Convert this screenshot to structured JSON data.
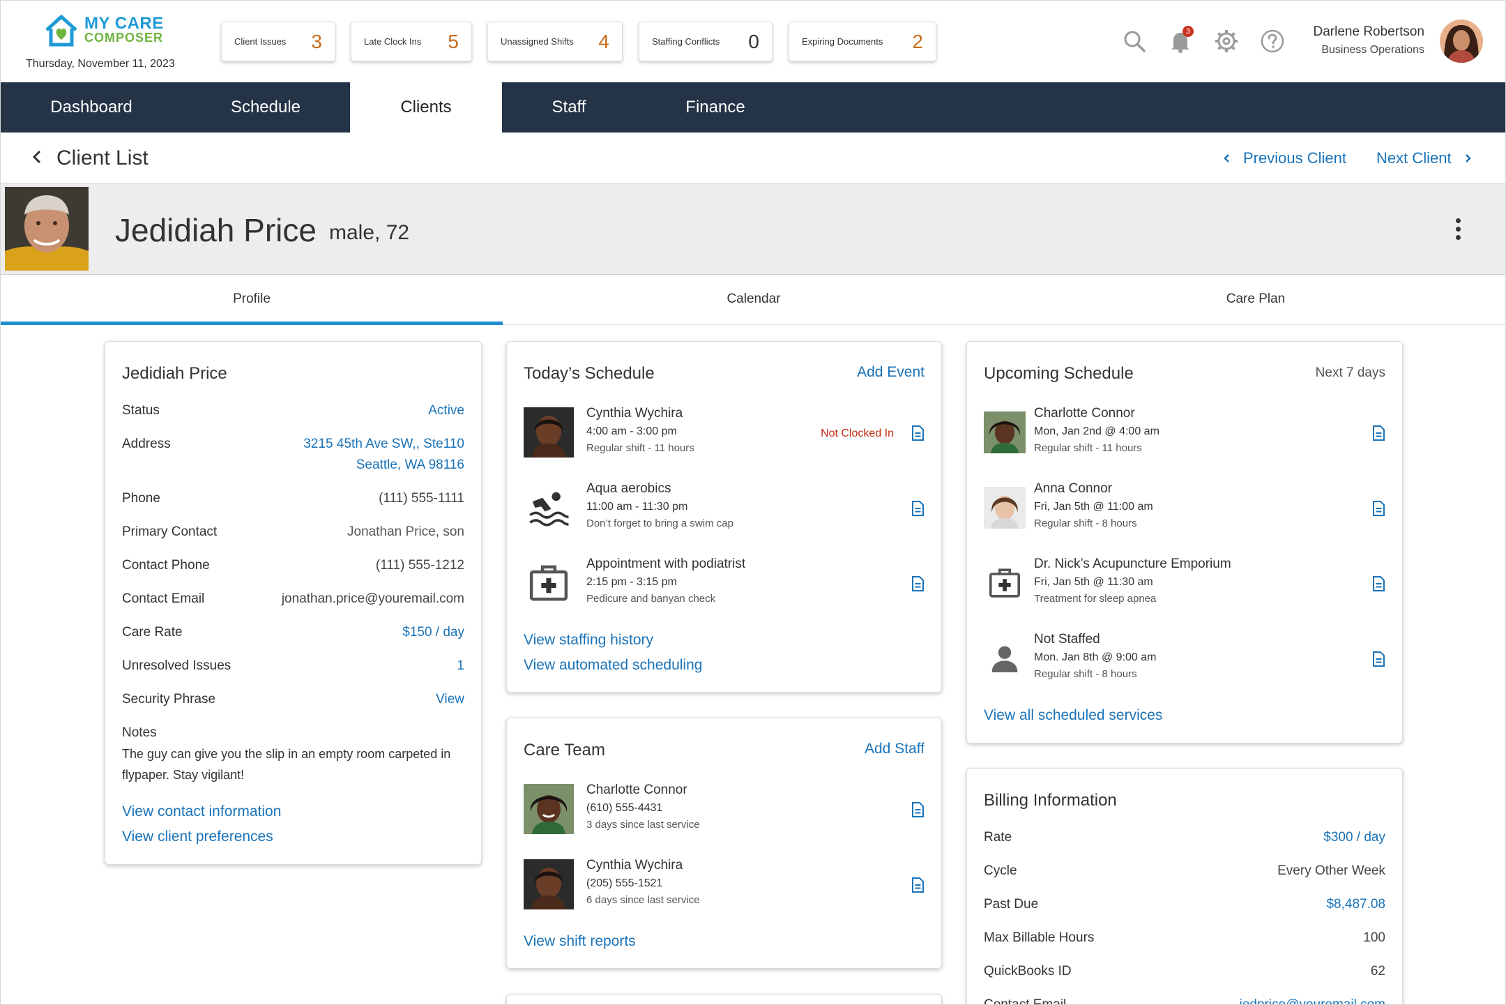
{
  "app": {
    "logo_top": "MY CARE",
    "logo_bottom": "COMPOSER",
    "date": "Thursday, November 11, 2023"
  },
  "kpis": [
    {
      "label": "Client Issues",
      "value": "3"
    },
    {
      "label": "Late Clock Ins",
      "value": "5"
    },
    {
      "label": "Unassigned Shifts",
      "value": "4"
    },
    {
      "label": "Staffing Conflicts",
      "value": "0"
    },
    {
      "label": "Expiring Documents",
      "value": "2"
    }
  ],
  "header_icons": {
    "notification_count": "3"
  },
  "user": {
    "name": "Darlene Robertson",
    "role": "Business Operations"
  },
  "nav": [
    {
      "label": "Dashboard"
    },
    {
      "label": "Schedule"
    },
    {
      "label": "Clients",
      "active": true
    },
    {
      "label": "Staff"
    },
    {
      "label": "Finance"
    }
  ],
  "subheader": {
    "back_label": "Client List",
    "previous_label": "Previous Client",
    "next_label": "Next Client"
  },
  "client": {
    "name": "Jedidiah Price",
    "meta": "male, 72"
  },
  "tabs": [
    {
      "label": "Profile",
      "active": true
    },
    {
      "label": "Calendar"
    },
    {
      "label": "Care Plan"
    }
  ],
  "profile_card": {
    "title": "Jedidiah Price",
    "rows": [
      {
        "key": "Status",
        "value": "Active"
      },
      {
        "key": "Address",
        "value": "3215 45th Ave SW,, Ste110",
        "value2": "Seattle, WA 98116"
      },
      {
        "key": "Phone",
        "value": "(111) 555-1111"
      },
      {
        "key": "Primary Contact",
        "value": "Jonathan Price, son"
      },
      {
        "key": "Contact Phone",
        "value": "(111) 555-1212"
      },
      {
        "key": "Contact Email",
        "value": "jonathan.price@youremail.com"
      },
      {
        "key": "Care Rate",
        "value": "$150 / day"
      },
      {
        "key": "Unresolved Issues",
        "value": "1"
      },
      {
        "key": "Security Phrase",
        "value": "View"
      }
    ],
    "notes_label": "Notes",
    "notes": "The guy can give you the slip in an empty room carpeted in flypaper.  Stay vigilant!",
    "link1": "View contact information",
    "link2": "View client preferences"
  },
  "todays_schedule": {
    "title": "Today’s Schedule",
    "action": "Add Event",
    "items": [
      {
        "title": "Cynthia Wychira",
        "line2": "4:00 am - 3:00 pm",
        "line3": "Regular shift - 11  hours",
        "status": "Not Clocked In",
        "icon": "avatar"
      },
      {
        "title": "Aqua aerobics",
        "line2": "11:00 am - 11:30 pm",
        "line3": "Don’t forget to bring a swim cap",
        "icon": "swimming-icon"
      },
      {
        "title": "Appointment with podiatrist",
        "line2": "2:15 pm - 3:15 pm",
        "line3": "Pedicure and banyan check",
        "icon": "medical-kit-icon"
      }
    ],
    "link1": "View staffing history",
    "link2": "View automated scheduling"
  },
  "care_team": {
    "title": "Care Team",
    "action": "Add Staff",
    "items": [
      {
        "title": "Charlotte Connor",
        "line2": "(610) 555-4431",
        "line3": "3 days since last service"
      },
      {
        "title": "Cynthia Wychira",
        "line2": "(205) 555-1521",
        "line3": "6 days since last service"
      }
    ],
    "link": "View shift reports"
  },
  "upcoming": {
    "title": "Upcoming Schedule",
    "note": "Next 7 days",
    "items": [
      {
        "title": "Charlotte Connor",
        "line2": "Mon, Jan 2nd @ 4:00 am",
        "line3": "Regular shift - 11 hours",
        "icon": "avatar"
      },
      {
        "title": "Anna Connor",
        "line2": "Fri, Jan 5th @ 11:00 am",
        "line3": "Regular shift - 8 hours",
        "icon": "avatar"
      },
      {
        "title": "Dr. Nick’s Acupuncture Emporium",
        "line2": "Fri, Jan 5th @ 11:30 am",
        "line3": "Treatment for sleep apnea",
        "icon": "medical-kit-icon"
      },
      {
        "title": "Not Staffed",
        "line2": "Mon. Jan 8th @ 9:00 am",
        "line3": "Regular shift - 8 hours",
        "icon": "person-icon"
      }
    ],
    "link": "View all scheduled services"
  },
  "billing": {
    "title": "Billing Information",
    "rows": [
      {
        "key": "Rate",
        "value": "$300 / day"
      },
      {
        "key": "Cycle",
        "value": "Every Other Week"
      },
      {
        "key": "Past Due",
        "value": "$8,487.08"
      },
      {
        "key": "Max Billable Hours",
        "value": "100"
      },
      {
        "key": "QuickBooks ID",
        "value": "62"
      },
      {
        "key": "Contact Email",
        "value": "jedprice@youremail.com"
      }
    ]
  },
  "colors": {
    "nav_bg": "#243446",
    "link": "#1a73b8",
    "accent": "#1f8fd1",
    "kpi_value": "#c86a1b",
    "alert": "#c0280f"
  }
}
